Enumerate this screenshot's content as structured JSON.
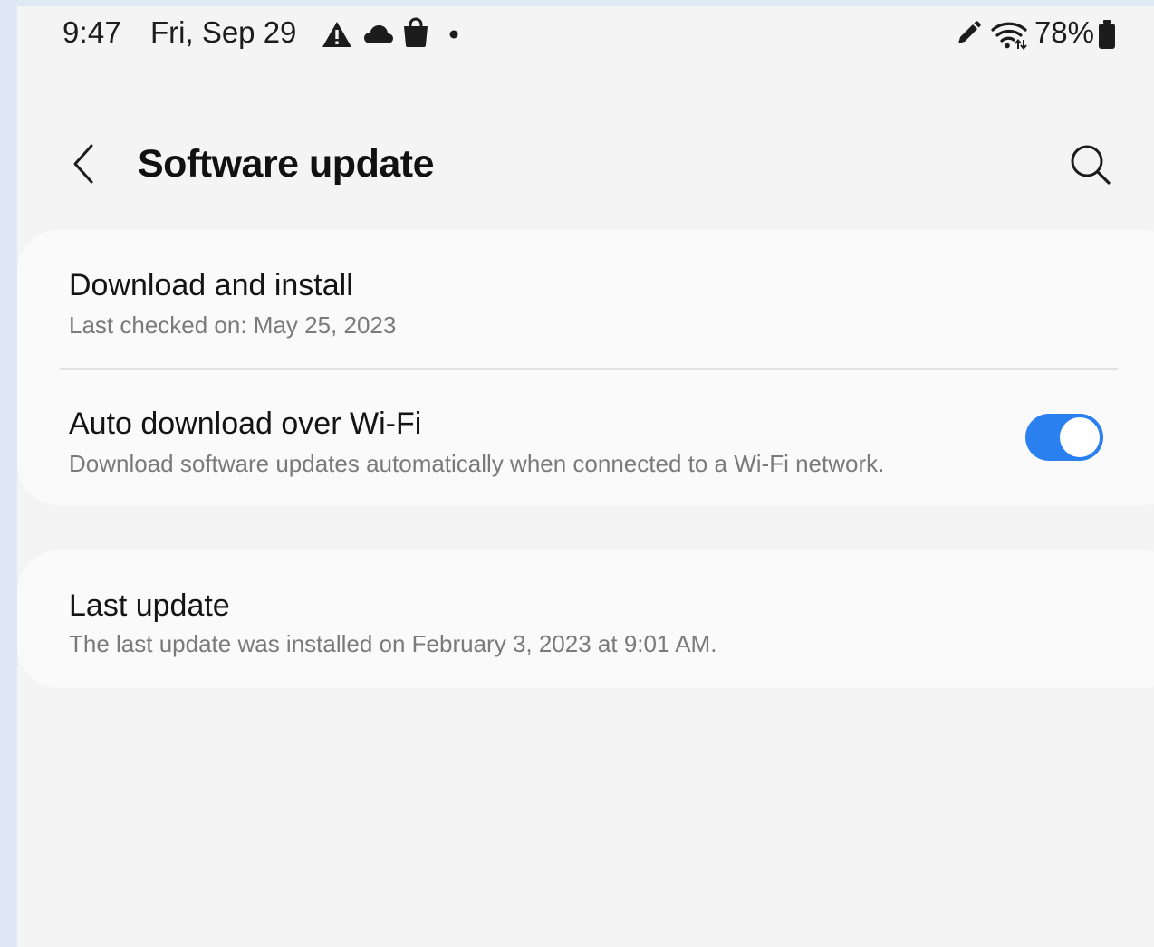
{
  "status_bar": {
    "time": "9:47",
    "date": "Fri, Sep 29",
    "battery": "78%",
    "icons_left": [
      "warning-icon",
      "cloud-icon",
      "shopping-bag-icon",
      "notification-dot-icon"
    ],
    "icons_right": [
      "pen-icon",
      "wifi-icon",
      "battery-icon"
    ]
  },
  "header": {
    "title": "Software update",
    "back_icon": "chevron-left-icon",
    "search_icon": "search-icon"
  },
  "settings": {
    "download_install": {
      "title": "Download and install",
      "subtitle": "Last checked on: May 25, 2023"
    },
    "auto_download": {
      "title": "Auto download over Wi-Fi",
      "subtitle": "Download software updates automatically when connected to a Wi-Fi network.",
      "enabled": true
    },
    "last_update": {
      "title": "Last update",
      "subtitle": "The last update was installed on February 3, 2023 at 9:01 AM."
    }
  },
  "colors": {
    "accent": "#2b80ef",
    "background": "#f4f4f4",
    "card": "#fafafa",
    "outer_frame": "#dee9f5"
  }
}
